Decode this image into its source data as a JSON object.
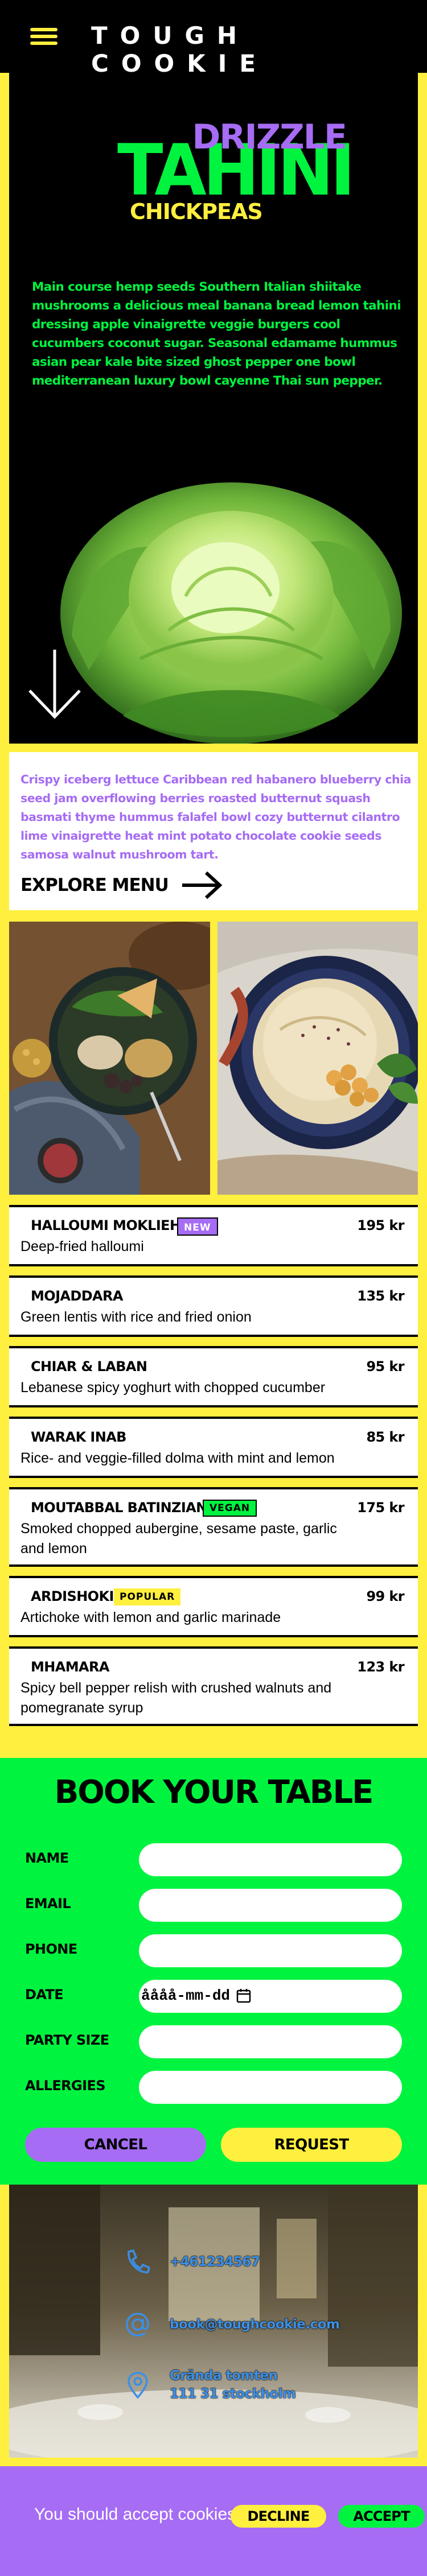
{
  "header": {
    "brand": "TOUGH COOKIE",
    "menu_icon": "hamburger-menu-icon",
    "colors": {
      "background": "#000000",
      "accent": "#ffef3e"
    }
  },
  "hero": {
    "title_top": "DRIZZLE",
    "title_main": "TAHINI",
    "title_bottom": "CHICKPEAS",
    "description": "Main course hemp seeds Southern Italian shiitake mushrooms a delicious meal banana bread lemon tahini dressing apple vinaigrette veggie burgers cool cucumbers coconut sugar. Seasonal edamame hummus asian pear kale bite sized ghost pepper one bowl mediterranean luxury bowl cayenne Thai sun pepper.",
    "image": "lettuce-photo",
    "scroll_icon": "arrow-down-icon"
  },
  "intro": {
    "text": "Crispy iceberg lettuce Caribbean red habanero blueberry chia seed jam overflowing berries roasted butternut squash basmati thyme hummus falafel bowl cozy butternut cilantro lime vinaigrette heat mint potato chocolate cookie seeds samosa walnut mushroom tart.",
    "explore_label": "EXPLORE MENU",
    "explore_icon": "arrow-right-icon"
  },
  "photos": [
    "mezze-bowl-photo",
    "hummus-chickpeas-photo"
  ],
  "menu": {
    "items": [
      {
        "name": "HALLOUMI MOKLIEH",
        "badge": "NEW",
        "description": "Deep-fried halloumi",
        "price": "195 kr"
      },
      {
        "name": "MOJADDARA",
        "badge": "",
        "description": "Green lentis with rice and fried onion",
        "price": "135 kr"
      },
      {
        "name": "CHIAR & LABAN",
        "badge": "",
        "description": "Lebanese spicy yoghurt with chopped cucumber",
        "price": "95 kr"
      },
      {
        "name": "WARAK INAB",
        "badge": "",
        "description": "Rice- and veggie-filled dolma with mint and lemon",
        "price": "85 kr"
      },
      {
        "name": "MOUTABBAL BATINZIAN",
        "badge": "VEGAN",
        "description": "Smoked chopped aubergine, sesame paste, garlic and lemon",
        "price": "175 kr"
      },
      {
        "name": "ARDISHOKI",
        "badge": "POPULAR",
        "description": "Artichoke with lemon and garlic marinade",
        "price": "99 kr"
      },
      {
        "name": "MHAMARA",
        "badge": "",
        "description": "Spicy bell pepper relish with crushed walnuts and pomegranate syrup",
        "price": "123 kr"
      }
    ]
  },
  "booking": {
    "title": "BOOK YOUR TABLE",
    "fields": {
      "name": {
        "label": "NAME",
        "value": ""
      },
      "email": {
        "label": "EMAIL",
        "value": ""
      },
      "phone": {
        "label": "PHONE",
        "value": ""
      },
      "date": {
        "label": "DATE",
        "value": "åååå-mm-dd"
      },
      "party": {
        "label": "PARTY SIZE",
        "value": ""
      },
      "allergies": {
        "label": "ALLERGIES",
        "value": ""
      }
    },
    "cancel_label": "CANCEL",
    "request_label": "REQUEST"
  },
  "contact": {
    "phone": "+461234567",
    "email": "book@toughcookie.com",
    "address_line1": "Grända tomten",
    "address_line2": "111 31 stockholm",
    "icons": [
      "phone-icon",
      "at-sign-icon",
      "map-pin-icon"
    ]
  },
  "cookie_bar": {
    "text": "You should accept cookies",
    "decline_label": "DECLINE",
    "accept_label": "ACCEPT"
  },
  "colors": {
    "yellow": "#ffef3e",
    "green": "#00f43f",
    "purple": "#a66cf4",
    "black": "#000000",
    "blue": "#3b8fe6"
  }
}
